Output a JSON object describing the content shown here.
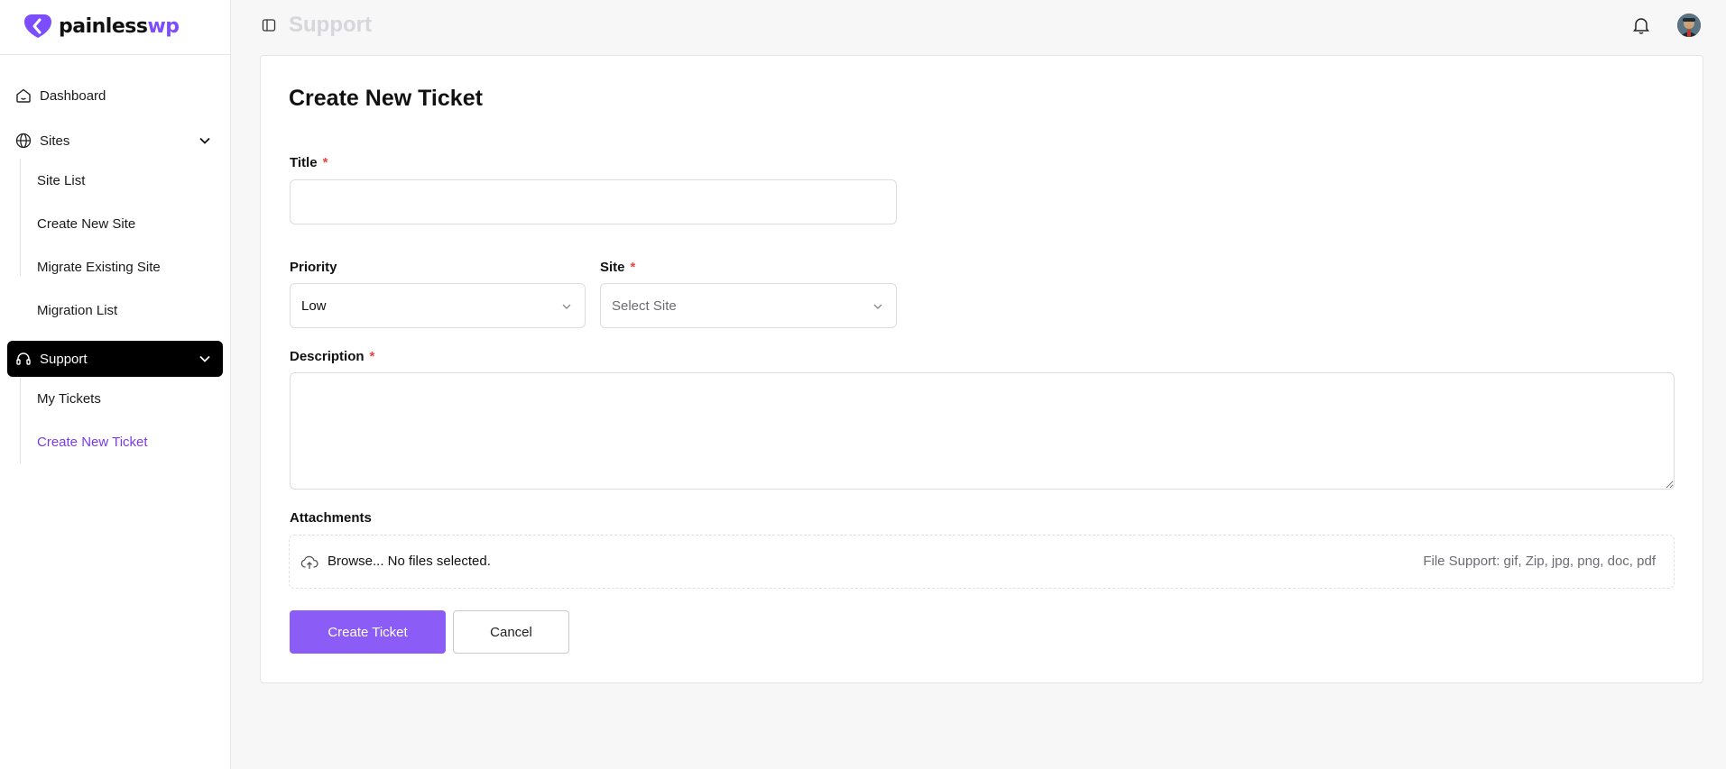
{
  "brand": {
    "name_prefix": "painless",
    "name_suffix": "wp",
    "accent": "#7c4dff"
  },
  "sidebar": {
    "items": [
      {
        "label": "Dashboard",
        "icon": "home-icon"
      },
      {
        "label": "Sites",
        "icon": "globe-icon",
        "expanded": true,
        "children": [
          "Site List",
          "Create New Site",
          "Migrate Existing Site",
          "Migration List"
        ]
      },
      {
        "label": "Support",
        "icon": "headset-icon",
        "expanded": true,
        "active": true,
        "children": [
          "My Tickets",
          "Create New Ticket"
        ]
      }
    ],
    "current_child": "Create New Ticket"
  },
  "header": {
    "title": "Support",
    "toggle_icon": "sidebar-toggle-icon",
    "notification_icon": "bell-icon"
  },
  "form": {
    "title": "Create New Ticket",
    "title_field": {
      "label": "Title",
      "required": "*",
      "value": ""
    },
    "priority": {
      "label": "Priority",
      "selected": "Low"
    },
    "site": {
      "label": "Site",
      "required": "*",
      "placeholder": "Select Site"
    },
    "description": {
      "label": "Description",
      "required": "*",
      "value": ""
    },
    "attachments": {
      "label": "Attachments",
      "browse_text": "Browse... No files selected.",
      "support_text": "File Support: gif, Zip, jpg, png, doc, pdf"
    },
    "submit_label": "Create Ticket",
    "cancel_label": "Cancel"
  },
  "colors": {
    "primary_button": "#8b5cf6",
    "active_nav": "#000000",
    "current_link": "#7c3aed",
    "required": "#ef4444"
  }
}
